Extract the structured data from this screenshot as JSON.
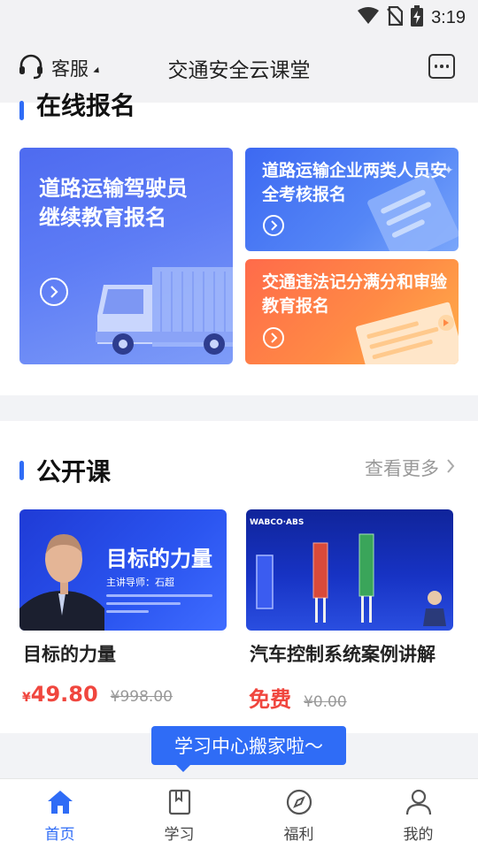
{
  "status_bar": {
    "time": "3:19"
  },
  "header": {
    "service_label": "客服",
    "title": "交通安全云课堂"
  },
  "online_registration": {
    "title": "在线报名",
    "cards": [
      {
        "label": "道路运输驾驶员继续教育报名"
      },
      {
        "label": "道路运输企业两类人员安全考核报名"
      },
      {
        "label": "交通违法记分满分和审验教育报名"
      }
    ]
  },
  "open_courses": {
    "title": "公开课",
    "more_label": "查看更多",
    "courses": [
      {
        "name": "目标的力量",
        "price_symbol": "¥",
        "price": "49.80",
        "original_price": "¥998.00",
        "thumb_title": "目标的力量",
        "thumb_lecturer": "主讲导师：石超"
      },
      {
        "name": "汽车控制系统案例讲解",
        "price": "免费",
        "original_price": "¥0.00",
        "thumb_brand": "WABCO·ABS"
      }
    ]
  },
  "tooltip": "学习中心搬家啦～",
  "bottom_nav": {
    "items": [
      {
        "label": "首页",
        "icon": "home-icon",
        "active": true
      },
      {
        "label": "学习",
        "icon": "book-icon",
        "active": false
      },
      {
        "label": "福利",
        "icon": "compass-icon",
        "active": false
      },
      {
        "label": "我的",
        "icon": "user-icon",
        "active": false
      }
    ]
  },
  "colors": {
    "accent": "#2f6cf6",
    "price_red": "#f0463e",
    "header_bg": "#f2f2f4",
    "card_orange": "#ff7a45"
  }
}
